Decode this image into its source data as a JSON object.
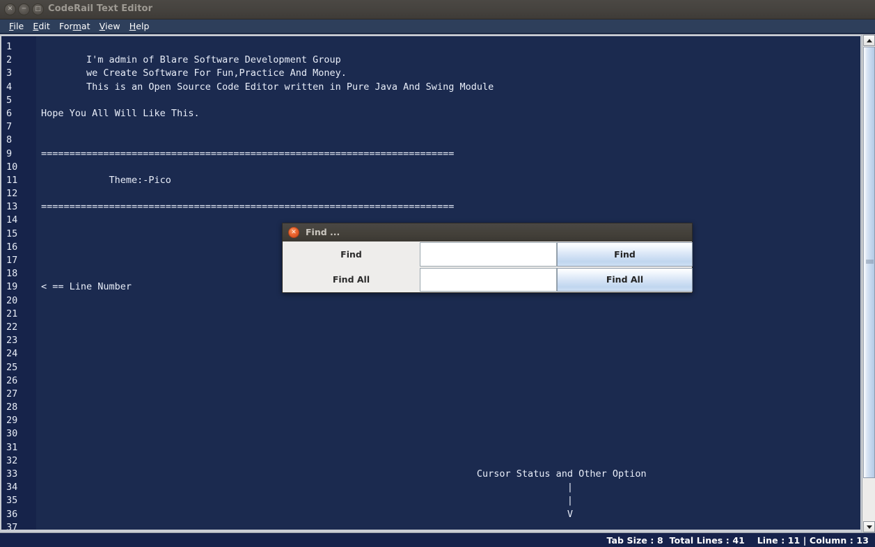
{
  "window": {
    "title": "CodeRail Text Editor",
    "buttons": [
      {
        "name": "close",
        "glyph": "✕"
      },
      {
        "name": "minimize",
        "glyph": "─"
      },
      {
        "name": "maximize",
        "glyph": "□"
      }
    ]
  },
  "menu": {
    "items": [
      {
        "label": "File",
        "mnemonic_index": 0
      },
      {
        "label": "Edit",
        "mnemonic_index": 0
      },
      {
        "label": "Format",
        "mnemonic_index": 3
      },
      {
        "label": "View",
        "mnemonic_index": 0
      },
      {
        "label": "Help",
        "mnemonic_index": 0
      }
    ]
  },
  "editor": {
    "first_line": 1,
    "last_visible_line": 37,
    "line_numbers": [
      1,
      2,
      3,
      4,
      5,
      6,
      7,
      8,
      9,
      10,
      11,
      12,
      13,
      14,
      15,
      16,
      17,
      18,
      19,
      20,
      21,
      22,
      23,
      24,
      25,
      26,
      27,
      28,
      29,
      30,
      31,
      32,
      33,
      34,
      35,
      36,
      37
    ],
    "lines": [
      "",
      "        I'm admin of Blare Software Development Group",
      "        we Create Software For Fun,Practice And Money.",
      "        This is an Open Source Code Editor written in Pure Java And Swing Module",
      "",
      "Hope You All Will Like This.",
      "",
      "",
      "=========================================================================",
      "",
      "            Theme:-Pico",
      "",
      "=========================================================================",
      "",
      "",
      "",
      "",
      "",
      "< == Line Number",
      "",
      "",
      "",
      "",
      "",
      "",
      "",
      "",
      "",
      "",
      "",
      "",
      "",
      "                                                                             Cursor Status and Other Option",
      "                                                                                             |",
      "                                                                                             |",
      "                                                                                             V",
      ""
    ]
  },
  "scrollbar": {
    "up_arrow": "scroll-up",
    "down_arrow": "scroll-down",
    "thumb": "scroll-thumb"
  },
  "status_bar": {
    "text": "Tab Size : 8  Total Lines : 41    Line : 11 | Column : 13",
    "tab_size": 8,
    "total_lines": 41,
    "line": 11,
    "column": 13
  },
  "find_dialog": {
    "title": "Find ...",
    "close_glyph": "✕",
    "rows": [
      {
        "label": "Find",
        "field_value": "",
        "field_placeholder": "",
        "button_label": "Find"
      },
      {
        "label": "Find All",
        "field_value": "",
        "field_placeholder": "",
        "button_label": "Find All"
      }
    ]
  },
  "colors": {
    "editor_bg": "#1b2a4f",
    "gutter_bg": "#16234a",
    "editor_fg": "#e9eef9",
    "menu_bg": "#2e3f5b",
    "titlebar_bg": "#45423e",
    "status_bg": "#16224b",
    "dialog_bg": "#eeedeb",
    "dialog_close": "#e9612c"
  }
}
